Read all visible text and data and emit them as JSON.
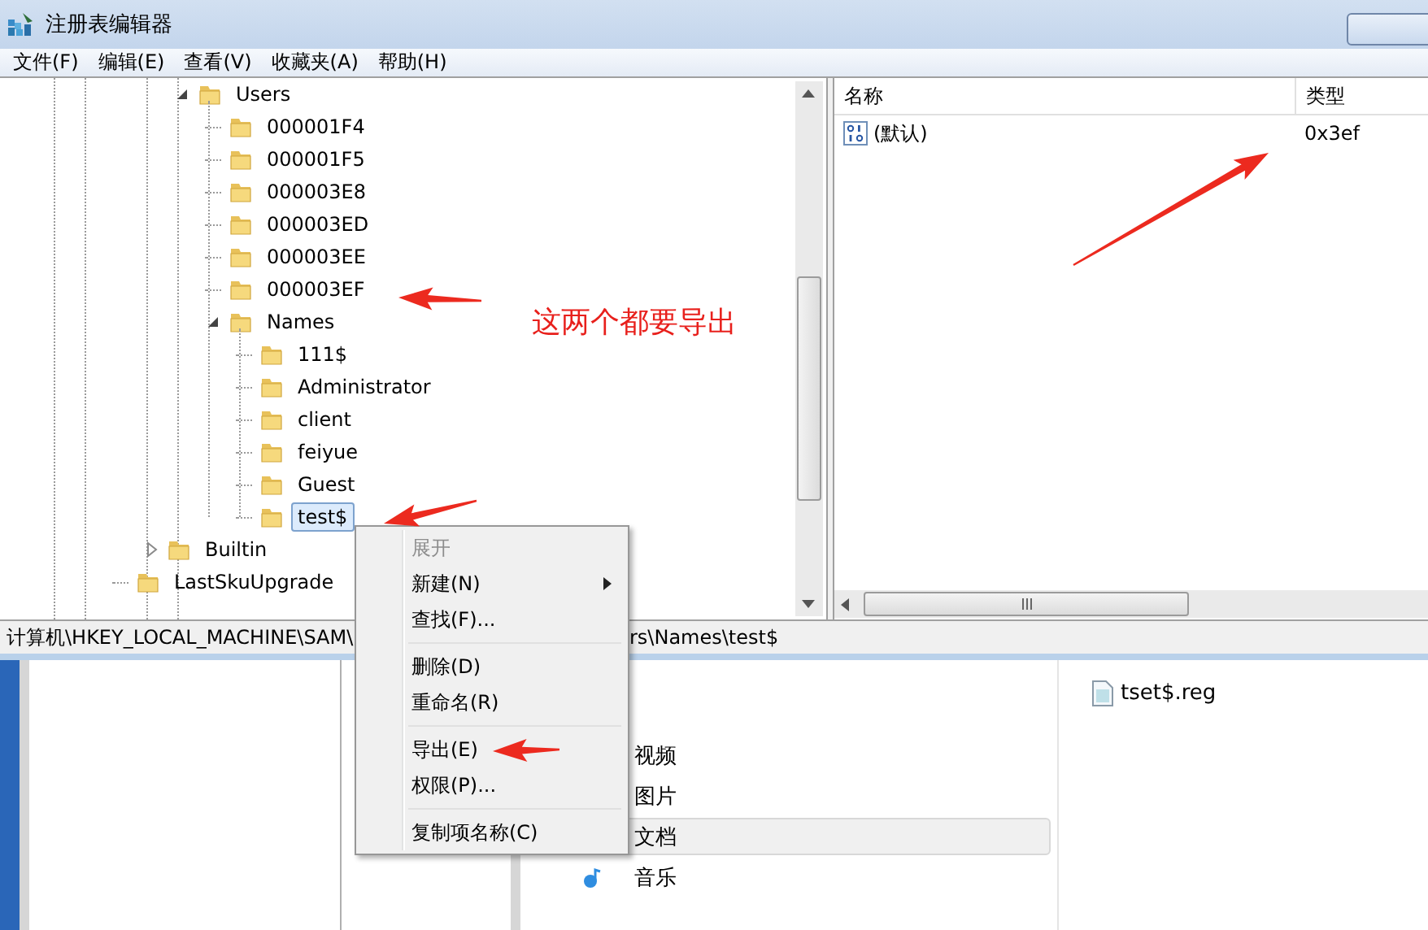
{
  "window": {
    "title": "注册表编辑器"
  },
  "menu_bar": [
    "文件(F)",
    "编辑(E)",
    "查看(V)",
    "收藏夹(A)",
    "帮助(H)"
  ],
  "tree": [
    {
      "children": [
        {
          "children": [
            {
              "label": "Users",
              "selected": false,
              "expanded": true,
              "children": [
                {
                  "label": "000001F4",
                  "selected": false
                },
                {
                  "label": "000001F5",
                  "selected": false
                },
                {
                  "label": "000003E8",
                  "selected": false
                },
                {
                  "label": "000003ED",
                  "selected": false
                },
                {
                  "label": "000003EE",
                  "selected": false
                },
                {
                  "label": "000003EF",
                  "selected": false
                },
                {
                  "label": "Names",
                  "selected": false,
                  "expanded": true,
                  "children": [
                    {
                      "label": "111$",
                      "selected": false
                    },
                    {
                      "label": "Administrator",
                      "selected": false
                    },
                    {
                      "label": "client",
                      "selected": false
                    },
                    {
                      "label": "feiyue",
                      "selected": false
                    },
                    {
                      "label": "Guest",
                      "selected": false
                    },
                    {
                      "label": "test$",
                      "selected": true
                    }
                  ]
                }
              ]
            }
          ]
        },
        {
          "label": "Builtin",
          "selected": false,
          "expanded": false
        }
      ]
    },
    {
      "label": "LastSkuUpgrade",
      "selected": false
    }
  ],
  "values": {
    "columns": [
      "名称",
      "类型"
    ],
    "rows": [
      {
        "name": "(默认)",
        "type": "0x3ef"
      }
    ]
  },
  "status_bar": {
    "path_left": "计算机\\HKEY_LOCAL_MACHINE\\SAM\\",
    "path_right": "rs\\Names\\test$"
  },
  "context_menu": [
    {
      "kind": "item",
      "label": "展开",
      "disabled": true,
      "submenu": false
    },
    {
      "kind": "item",
      "label": "新建(N)",
      "disabled": false,
      "submenu": true
    },
    {
      "kind": "item",
      "label": "查找(F)...",
      "disabled": false,
      "submenu": false
    },
    {
      "kind": "separator"
    },
    {
      "kind": "item",
      "label": "删除(D)",
      "disabled": false,
      "submenu": false
    },
    {
      "kind": "item",
      "label": "重命名(R)",
      "disabled": false,
      "submenu": false
    },
    {
      "kind": "separator"
    },
    {
      "kind": "item",
      "label": "导出(E)",
      "disabled": false,
      "submenu": false
    },
    {
      "kind": "item",
      "label": "权限(P)...",
      "disabled": false,
      "submenu": false
    },
    {
      "kind": "separator"
    },
    {
      "kind": "item",
      "label": "复制项名称(C)",
      "disabled": false,
      "submenu": false
    }
  ],
  "annotation": {
    "text": "这两个都要导出"
  },
  "explorer": {
    "nav": [
      {
        "label": "视频",
        "selected": false
      },
      {
        "label": "图片",
        "selected": false
      },
      {
        "label": "文档",
        "selected": true
      },
      {
        "label": "音乐",
        "selected": false
      }
    ],
    "files": [
      {
        "name": "tset$.reg"
      }
    ]
  }
}
